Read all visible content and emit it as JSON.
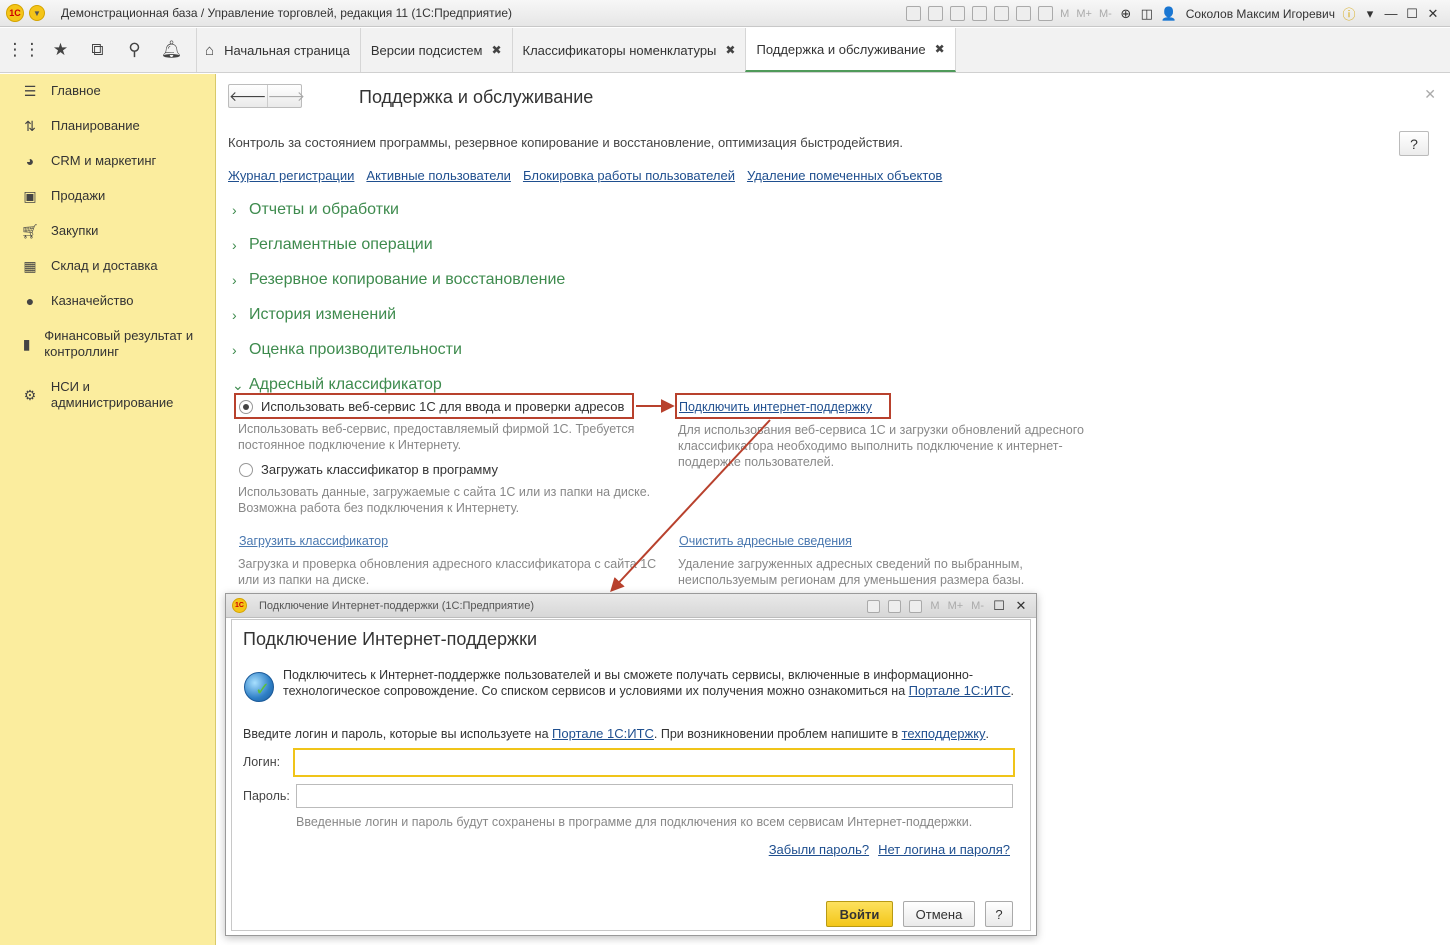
{
  "window": {
    "title": "Демонстрационная база / Управление торговлей, редакция 11  (1С:Предприятие)",
    "logo_text": "1С",
    "user": "Соколов Максим Игоревич",
    "tools_text": [
      "M",
      "M+",
      "M-"
    ]
  },
  "tabs": [
    {
      "label": "Начальная страница",
      "home": true
    },
    {
      "label": "Версии подсистем",
      "closable": true
    },
    {
      "label": "Классификаторы номенклатуры",
      "closable": true
    },
    {
      "label": "Поддержка и обслуживание",
      "closable": true,
      "active": true
    }
  ],
  "sidebar": {
    "items": [
      {
        "label": "Главное",
        "icon": "menu-icon"
      },
      {
        "label": "Планирование",
        "icon": "planning-icon"
      },
      {
        "label": "CRM и маркетинг",
        "icon": "pie-chart-icon"
      },
      {
        "label": "Продажи",
        "icon": "bag-icon"
      },
      {
        "label": "Закупки",
        "icon": "cart-icon"
      },
      {
        "label": "Склад и доставка",
        "icon": "grid-icon"
      },
      {
        "label": "Казначейство",
        "icon": "coin-icon"
      },
      {
        "label": "Финансовый результат и контроллинг",
        "icon": "bar-chart-icon"
      },
      {
        "label": "НСИ и администрирование",
        "icon": "gear-icon"
      }
    ]
  },
  "main": {
    "title": "Поддержка и обслуживание",
    "description": "Контроль за состоянием программы, резервное копирование и восстановление, оптимизация быстродействия.",
    "help": "?",
    "links": [
      "Журнал регистрации",
      "Активные пользователи",
      "Блокировка работы пользователей",
      "Удаление помеченных объектов"
    ],
    "groups": [
      {
        "label": "Отчеты и обработки",
        "expanded": false
      },
      {
        "label": "Регламентные операции",
        "expanded": false
      },
      {
        "label": "Резервное копирование и восстановление",
        "expanded": false
      },
      {
        "label": "История изменений",
        "expanded": false
      },
      {
        "label": "Оценка производительности",
        "expanded": false
      },
      {
        "label": "Адресный классификатор",
        "expanded": true
      }
    ],
    "address": {
      "opt_web": "Использовать веб-сервис 1С для ввода и проверки адресов",
      "opt_web_hint": "Использовать веб-сервис, предоставляемый фирмой 1С. Требуется постоянное подключение к Интернету.",
      "opt_load": "Загружать классификатор в программу",
      "opt_load_hint": "Использовать данные, загружаемые с сайта 1С или из папки на диске. Возможна работа без подключения к Интернету.",
      "connect_link": "Подключить интернет-поддержку",
      "connect_hint": "Для использования веб-сервиса 1С и загрузки обновлений адресного классификатора необходимо выполнить подключение к интернет-поддержке пользователей.",
      "load_link": "Загрузить классификатор",
      "load_hint": "Загрузка и проверка обновления адресного классификатора с сайта 1С или из папки на диске.",
      "clear_link": "Очистить адресные сведения",
      "clear_hint": "Удаление загруженных адресных сведений по выбранным, неиспользуемым регионам для уменьшения размера базы."
    }
  },
  "dialog": {
    "window_title": "Подключение Интернет-поддержки  (1С:Предприятие)",
    "heading": "Подключение Интернет-поддержки",
    "intro": "Подключитесь к Интернет-поддержке пользователей и вы сможете получать сервисы, включенные в информационно-технологическое сопровождение. Со списком сервисов и условиями их получения можно ознакомиться на",
    "intro_link": "Портале 1С:ИТС",
    "intro_end": ".",
    "prompt_start": "Введите логин и пароль, которые вы используете на",
    "prompt_link": "Портале 1С:ИТС",
    "prompt_mid": ". При возникновении проблем напишите в",
    "prompt_link2": "техподдержку",
    "prompt_end": ".",
    "login_label": "Логин:",
    "login_value": "",
    "password_label": "Пароль:",
    "password_value": "",
    "note": "Введенные логин и пароль будут сохранены в программе для подключения ко всем сервисам Интернет-поддержки.",
    "forgot_link": "Забыли пароль?",
    "no_login_link": "Нет логина и пароля?",
    "ok": "Войти",
    "cancel": "Отмена",
    "help": "?"
  },
  "colors": {
    "sidebar_bg": "#fbed9e",
    "group_green": "#3e8b4e",
    "link_blue": "#1f4f8f",
    "annotation_red": "#b8412d",
    "ok_yellow": "#f3c619"
  }
}
